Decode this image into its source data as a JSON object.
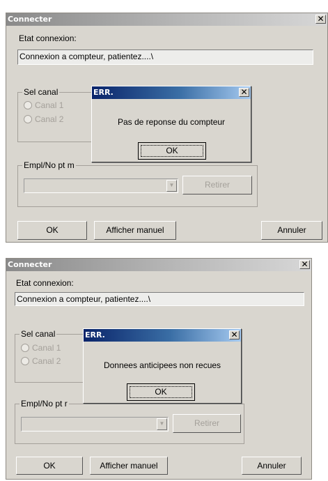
{
  "dialogs": [
    {
      "title": "Connecter",
      "close_glyph": "✕",
      "status_label": "Etat connexion:",
      "status_text": "Connexion a compteur, patientez....\\",
      "channel_group_label": "Sel canal",
      "channels": [
        "Canal 1",
        "Canal 2"
      ],
      "location_group_label": "Empl/No pt m",
      "combo_arrow": "▼",
      "remove_label": "Retirer",
      "ok_label": "OK",
      "show_manual_label": "Afficher manuel",
      "cancel_label": "Annuler",
      "error": {
        "title": "ERR.",
        "close_glyph": "✕",
        "message": "Pas de reponse du compteur",
        "ok_label": "OK"
      }
    },
    {
      "title": "Connecter",
      "close_glyph": "✕",
      "status_label": "Etat connexion:",
      "status_text": "Connexion a compteur, patientez....\\",
      "channel_group_label": "Sel canal",
      "channels": [
        "Canal 1",
        "Canal 2"
      ],
      "location_group_label": "Empl/No pt r",
      "combo_arrow": "▼",
      "remove_label": "Retirer",
      "ok_label": "OK",
      "show_manual_label": "Afficher manuel",
      "cancel_label": "Annuler",
      "error": {
        "title": "ERR.",
        "close_glyph": "✕",
        "message": "Donnees anticipees non recues",
        "ok_label": "OK"
      }
    }
  ],
  "colors": {
    "dialog_bg": "#d9d6cf",
    "inactive_title": "#8a8a8a",
    "active_title": "#0a246a"
  }
}
